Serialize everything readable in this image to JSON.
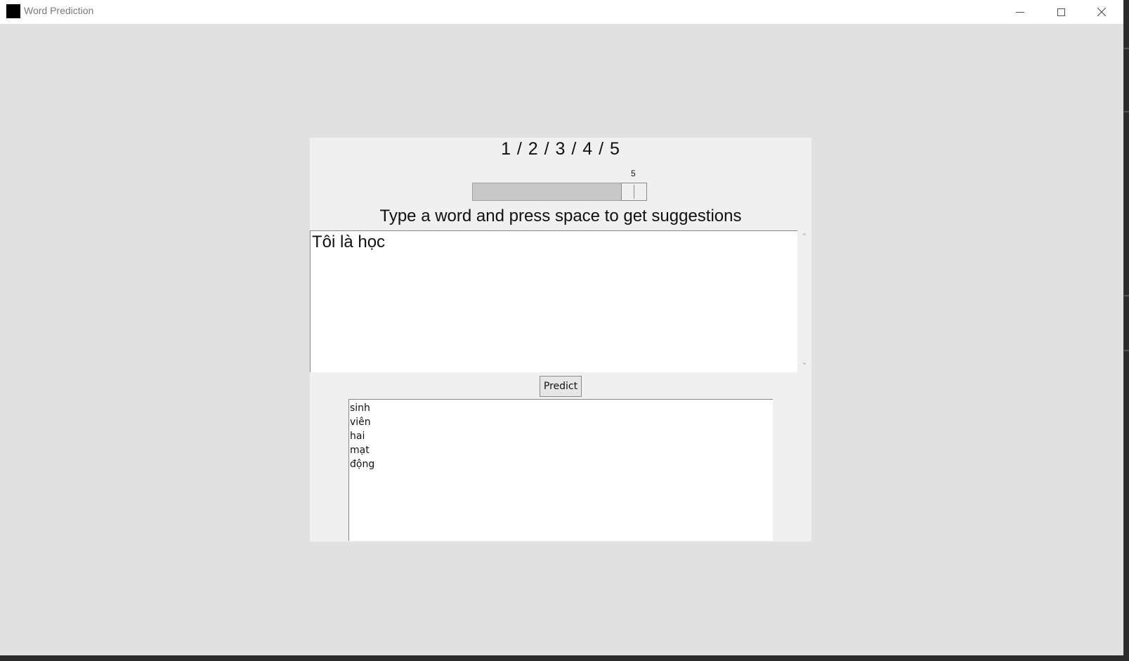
{
  "window": {
    "title": "Word Prediction",
    "controls": {
      "minimize": "─",
      "maximize": "□",
      "close": "✕"
    }
  },
  "choices_label": "1  / 2  / 3  / 4  / 5",
  "scale": {
    "value": "5"
  },
  "instruction": "Type a word and press space to get suggestions",
  "input_text": "Tôi là học",
  "scrollbar": {
    "up": "⌃",
    "down": "⌄"
  },
  "predict_button": "Predict",
  "suggestions": [
    "sinh",
    "viên",
    "hai",
    "mạt",
    "động"
  ]
}
